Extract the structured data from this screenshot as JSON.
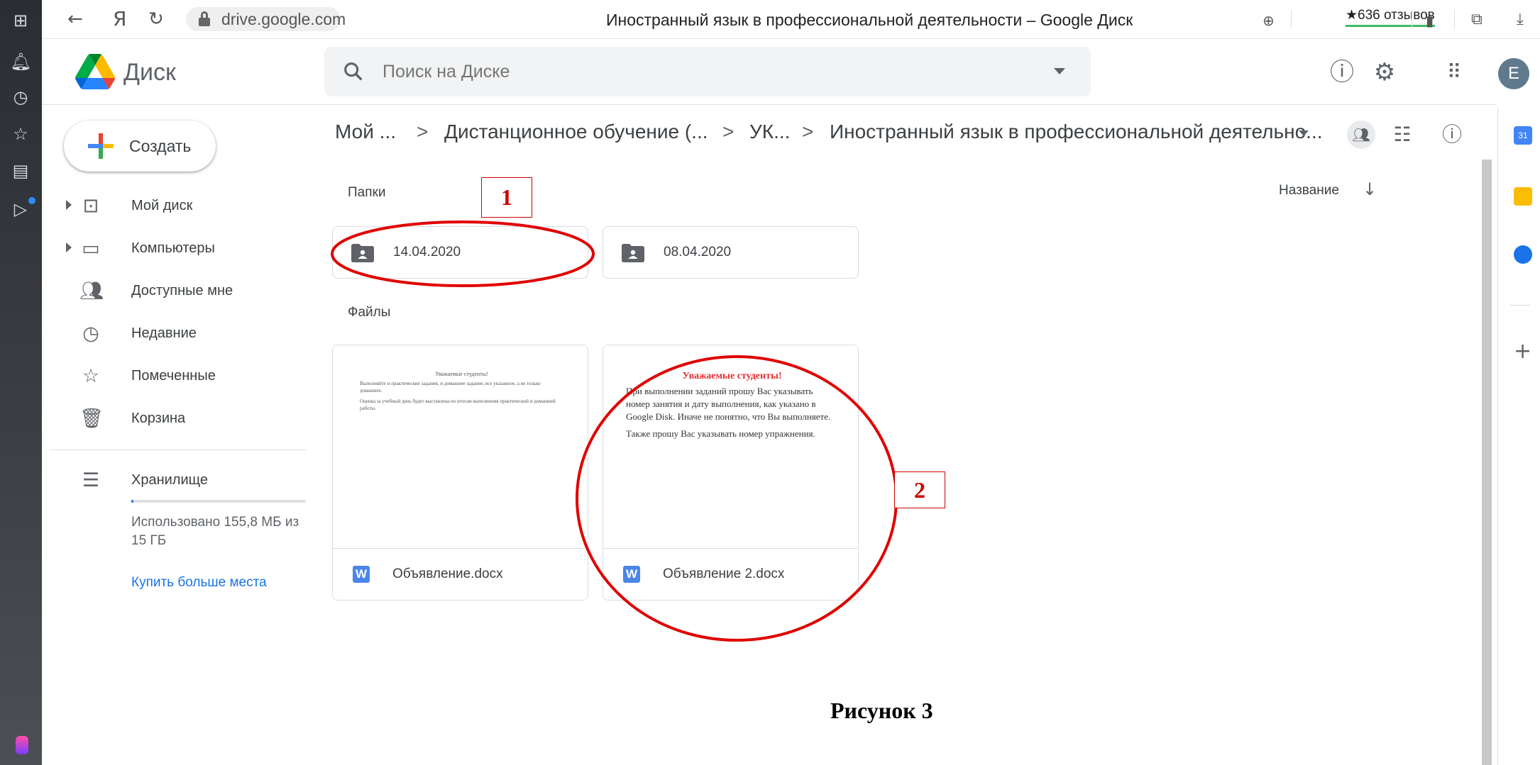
{
  "browser": {
    "url": "drive.google.com",
    "page_title": "Иностранный язык в профессиональной деятельности – Google Диск",
    "reviews": "★636 отзывов",
    "yandex_glyph": "Я"
  },
  "header": {
    "app_name": "Диск",
    "search_placeholder": "Поиск на Диске",
    "avatar_letter": "E"
  },
  "nav": {
    "create_label": "Создать",
    "items": [
      {
        "label": "Мой диск",
        "icon": "my-drive-icon"
      },
      {
        "label": "Компьютеры",
        "icon": "computers-icon"
      },
      {
        "label": "Доступные мне",
        "icon": "shared-with-me-icon"
      },
      {
        "label": "Недавние",
        "icon": "clock-icon"
      },
      {
        "label": "Помеченные",
        "icon": "star-icon"
      },
      {
        "label": "Корзина",
        "icon": "trash-icon"
      }
    ],
    "storage_label": "Хранилище",
    "storage_used": "Использовано 155,8 МБ из 15 ГБ",
    "storage_used_fraction": 0.0104,
    "buy_more": "Купить больше места"
  },
  "breadcrumb": {
    "items": [
      "Мой ...",
      "Дистанционное обучение (...",
      "УК...",
      "Иностранный язык в профессиональной деятельно..."
    ],
    "separator": ">"
  },
  "content": {
    "folders_title": "Папки",
    "files_title": "Файлы",
    "sort_label": "Название",
    "folders": [
      {
        "name": "14.04.2020"
      },
      {
        "name": "08.04.2020"
      }
    ],
    "files": [
      {
        "name": "Объявление.docx",
        "preview_title": "Уважаемые студенты!",
        "preview_lines": [
          "Выполняйте и практические задания, и домашнее задание, все указанное, а не только домашнее.",
          "Оценка за учебный день будет выставлена по итогам выполнения практической и домашней работы."
        ]
      },
      {
        "name": "Объявление 2.docx",
        "preview_title": "Уважаемые студенты!",
        "preview_lines": [
          "При выполнении заданий прошу Вас указывать номер занятия и дату выполнения, как указано в Google Disk. Иначе не понятно, что Вы выполняете.",
          "Также прошу Вас указывать номер упражнения."
        ]
      }
    ]
  },
  "annotations": {
    "label1": "1",
    "label2": "2",
    "caption": "Рисунок 3",
    "color": "#e00000"
  },
  "side_panel": {
    "calendar_day": "31"
  },
  "colors": {
    "accent": "#1a73e8",
    "text": "#3c4043",
    "border": "#dadce0"
  }
}
